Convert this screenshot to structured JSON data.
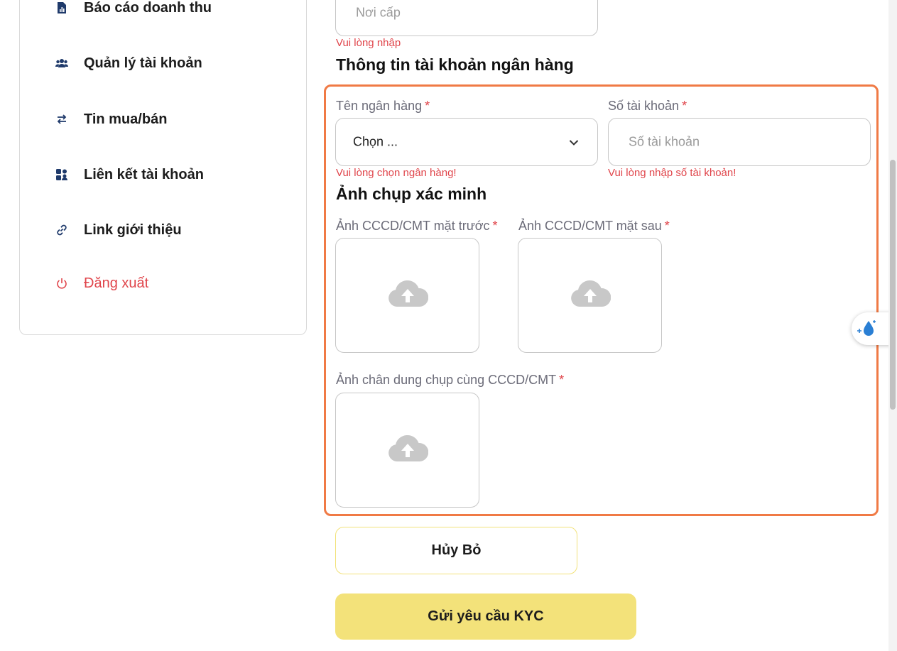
{
  "sidebar": {
    "items": [
      {
        "label": "Báo cáo doanh thu",
        "icon": "report-icon"
      },
      {
        "label": "Quản lý tài khoản",
        "icon": "users-icon"
      },
      {
        "label": "Tin mua/bán",
        "icon": "swap-icon"
      },
      {
        "label": "Liên kết tài khoản",
        "icon": "link-accounts-icon"
      },
      {
        "label": "Link giới thiệu",
        "icon": "chain-link-icon"
      },
      {
        "label": "Đăng xuất",
        "icon": "power-icon"
      }
    ]
  },
  "form": {
    "issue_place": {
      "placeholder": "Nơi cấp",
      "error": "Vui lòng nhập"
    },
    "bank_section_title": "Thông tin tài khoản ngân hàng",
    "bank_name": {
      "label": "Tên ngân hàng",
      "required": "*",
      "value": "Chọn ...",
      "error": "Vui lòng chọn ngân hàng!"
    },
    "account_number": {
      "label": "Số tài khoản",
      "required": "*",
      "placeholder": "Số tài khoản",
      "error": "Vui lòng nhập số tài khoản!"
    },
    "photo_section_title": "Ảnh chụp xác minh",
    "front_photo": {
      "label": "Ảnh CCCD/CMT mặt trước",
      "required": "*"
    },
    "back_photo": {
      "label": "Ảnh CCCD/CMT mặt sau",
      "required": "*"
    },
    "portrait_photo": {
      "label": "Ảnh chân dung chụp cùng CCCD/CMT",
      "required": "*"
    }
  },
  "buttons": {
    "cancel": "Hủy Bỏ",
    "submit": "Gửi yêu cầu KYC"
  },
  "colors": {
    "accent_yellow": "#f3e27a",
    "error_red": "#e0454b",
    "highlight_orange": "#f07a45",
    "icon_navy": "#1f3a6b"
  }
}
